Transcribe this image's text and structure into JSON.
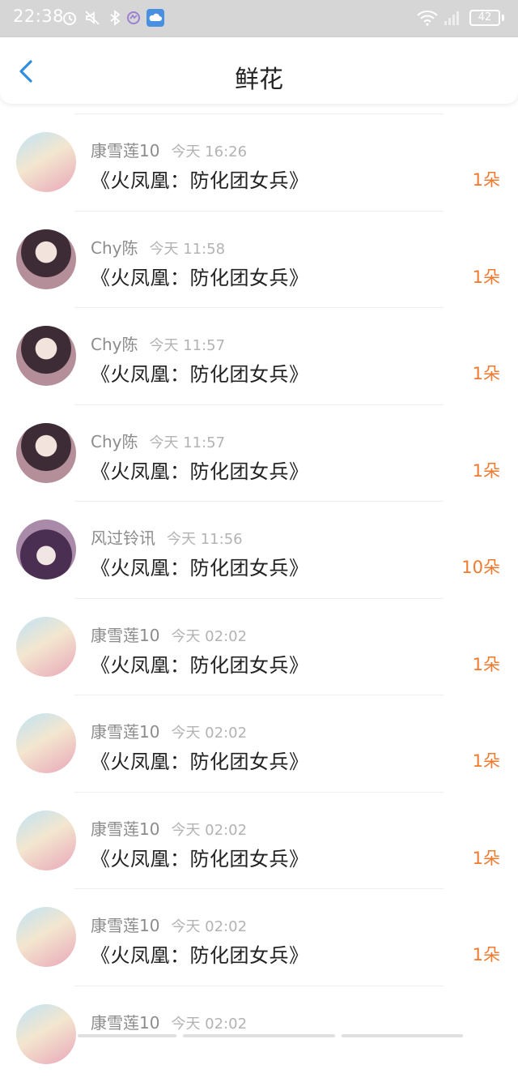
{
  "status_bar": {
    "time": "22:38",
    "battery": "42",
    "icons": [
      "alarm-icon",
      "mute-icon",
      "bluetooth-icon",
      "app-icon",
      "cloud-icon",
      "wifi-icon",
      "signal-icon",
      "battery-icon"
    ]
  },
  "header": {
    "title": "鲜花",
    "back_icon": "chevron-left-icon",
    "accent": "#2f8de4"
  },
  "colors": {
    "count": "#f07a2e",
    "username": "#8c8c8c",
    "time": "#b3b3b3"
  },
  "items": [
    {
      "user": "康雪莲10",
      "time": "今天 16:26",
      "title": "《火凤凰：防化团女兵》",
      "count": "1朵"
    },
    {
      "user": "Chy陈",
      "time": "今天 11:58",
      "title": "《火凤凰：防化团女兵》",
      "count": "1朵"
    },
    {
      "user": "Chy陈",
      "time": "今天 11:57",
      "title": "《火凤凰：防化团女兵》",
      "count": "1朵"
    },
    {
      "user": "Chy陈",
      "time": "今天 11:57",
      "title": "《火凤凰：防化团女兵》",
      "count": "1朵"
    },
    {
      "user": "风过铃讯",
      "time": "今天 11:56",
      "title": "《火凤凰：防化团女兵》",
      "count": "10朵"
    },
    {
      "user": "康雪莲10",
      "time": "今天 02:02",
      "title": "《火凤凰：防化团女兵》",
      "count": "1朵"
    },
    {
      "user": "康雪莲10",
      "time": "今天 02:02",
      "title": "《火凤凰：防化团女兵》",
      "count": "1朵"
    },
    {
      "user": "康雪莲10",
      "time": "今天 02:02",
      "title": "《火凤凰：防化团女兵》",
      "count": "1朵"
    },
    {
      "user": "康雪莲10",
      "time": "今天 02:02",
      "title": "《火凤凰：防化团女兵》",
      "count": "1朵"
    },
    {
      "user": "康雪莲10",
      "time": "今天 02:02"
    }
  ]
}
